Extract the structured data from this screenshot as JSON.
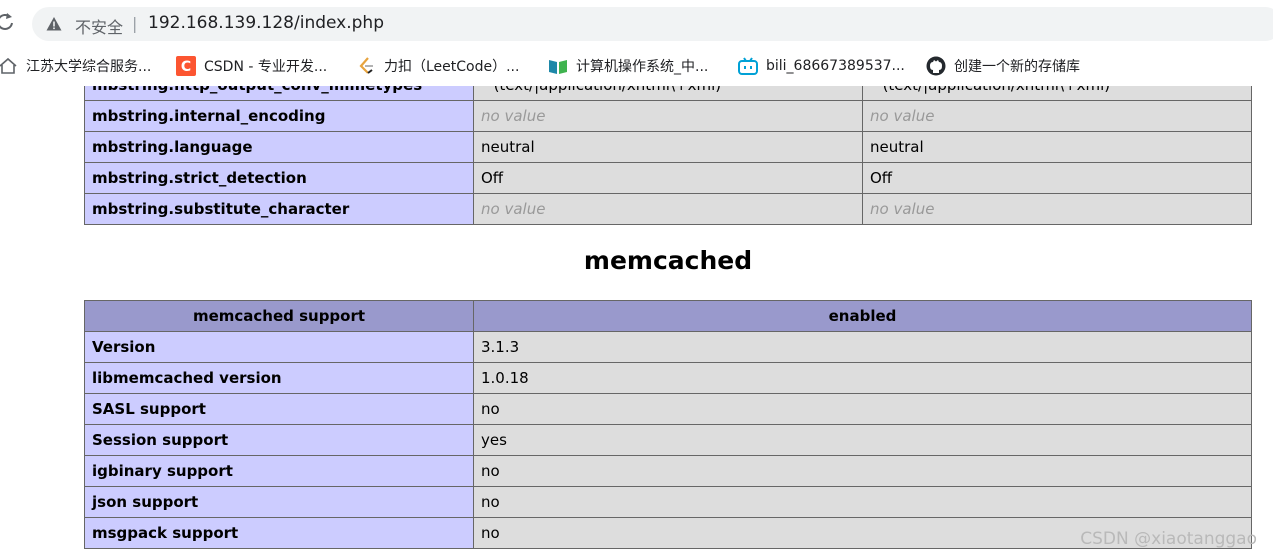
{
  "browser": {
    "security_label": "不安全",
    "separator": "|",
    "url": "192.168.139.128/index.php"
  },
  "bookmarks": [
    {
      "label": "江苏大学综合服务...",
      "icon": "home-icon"
    },
    {
      "label": "CSDN - 专业开发...",
      "icon": "csdn-icon"
    },
    {
      "label": "力扣（LeetCode）...",
      "icon": "leetcode-icon"
    },
    {
      "label": "计算机操作系统_中...",
      "icon": "book-icon"
    },
    {
      "label": "bili_68667389537...",
      "icon": "bilibili-icon"
    },
    {
      "label": "创建一个新的存储库",
      "icon": "github-icon"
    }
  ],
  "mbstring_rows": [
    {
      "name": "mbstring.http_output_conv_mimetypes",
      "local": "^(text/|application/xhtml\\+xml)",
      "master": "^(text/|application/xhtml\\+xml)"
    },
    {
      "name": "mbstring.internal_encoding",
      "local": "no value",
      "master": "no value"
    },
    {
      "name": "mbstring.language",
      "local": "neutral",
      "master": "neutral"
    },
    {
      "name": "mbstring.strict_detection",
      "local": "Off",
      "master": "Off"
    },
    {
      "name": "mbstring.substitute_character",
      "local": "no value",
      "master": "no value"
    }
  ],
  "memcached": {
    "heading": "memcached",
    "header": {
      "name": "memcached support",
      "value": "enabled"
    },
    "rows": [
      {
        "name": "Version",
        "value": "3.1.3"
      },
      {
        "name": "libmemcached version",
        "value": "1.0.18"
      },
      {
        "name": "SASL support",
        "value": "no"
      },
      {
        "name": "Session support",
        "value": "yes"
      },
      {
        "name": "igbinary support",
        "value": "no"
      },
      {
        "name": "json support",
        "value": "no"
      },
      {
        "name": "msgpack support",
        "value": "no"
      }
    ]
  },
  "watermark": "CSDN @xiaotanggao",
  "colors": {
    "entry_bg": "#ccccff",
    "value_bg": "#dddddd",
    "header_bg": "#9999cc",
    "no_value_text": "#999999"
  }
}
